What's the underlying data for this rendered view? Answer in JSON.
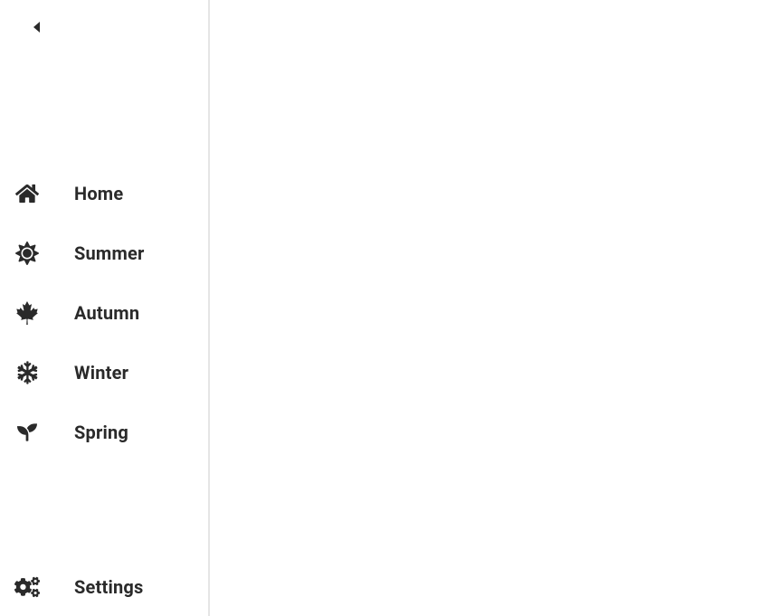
{
  "sidebar": {
    "nav": [
      {
        "id": "home",
        "label": "Home",
        "icon": "home-icon"
      },
      {
        "id": "summer",
        "label": "Summer",
        "icon": "sun-icon"
      },
      {
        "id": "autumn",
        "label": "Autumn",
        "icon": "leaf-icon"
      },
      {
        "id": "winter",
        "label": "Winter",
        "icon": "snowflake-icon"
      },
      {
        "id": "spring",
        "label": "Spring",
        "icon": "seedling-icon"
      }
    ],
    "footer": {
      "label": "Settings",
      "icon": "cogs-icon"
    }
  }
}
